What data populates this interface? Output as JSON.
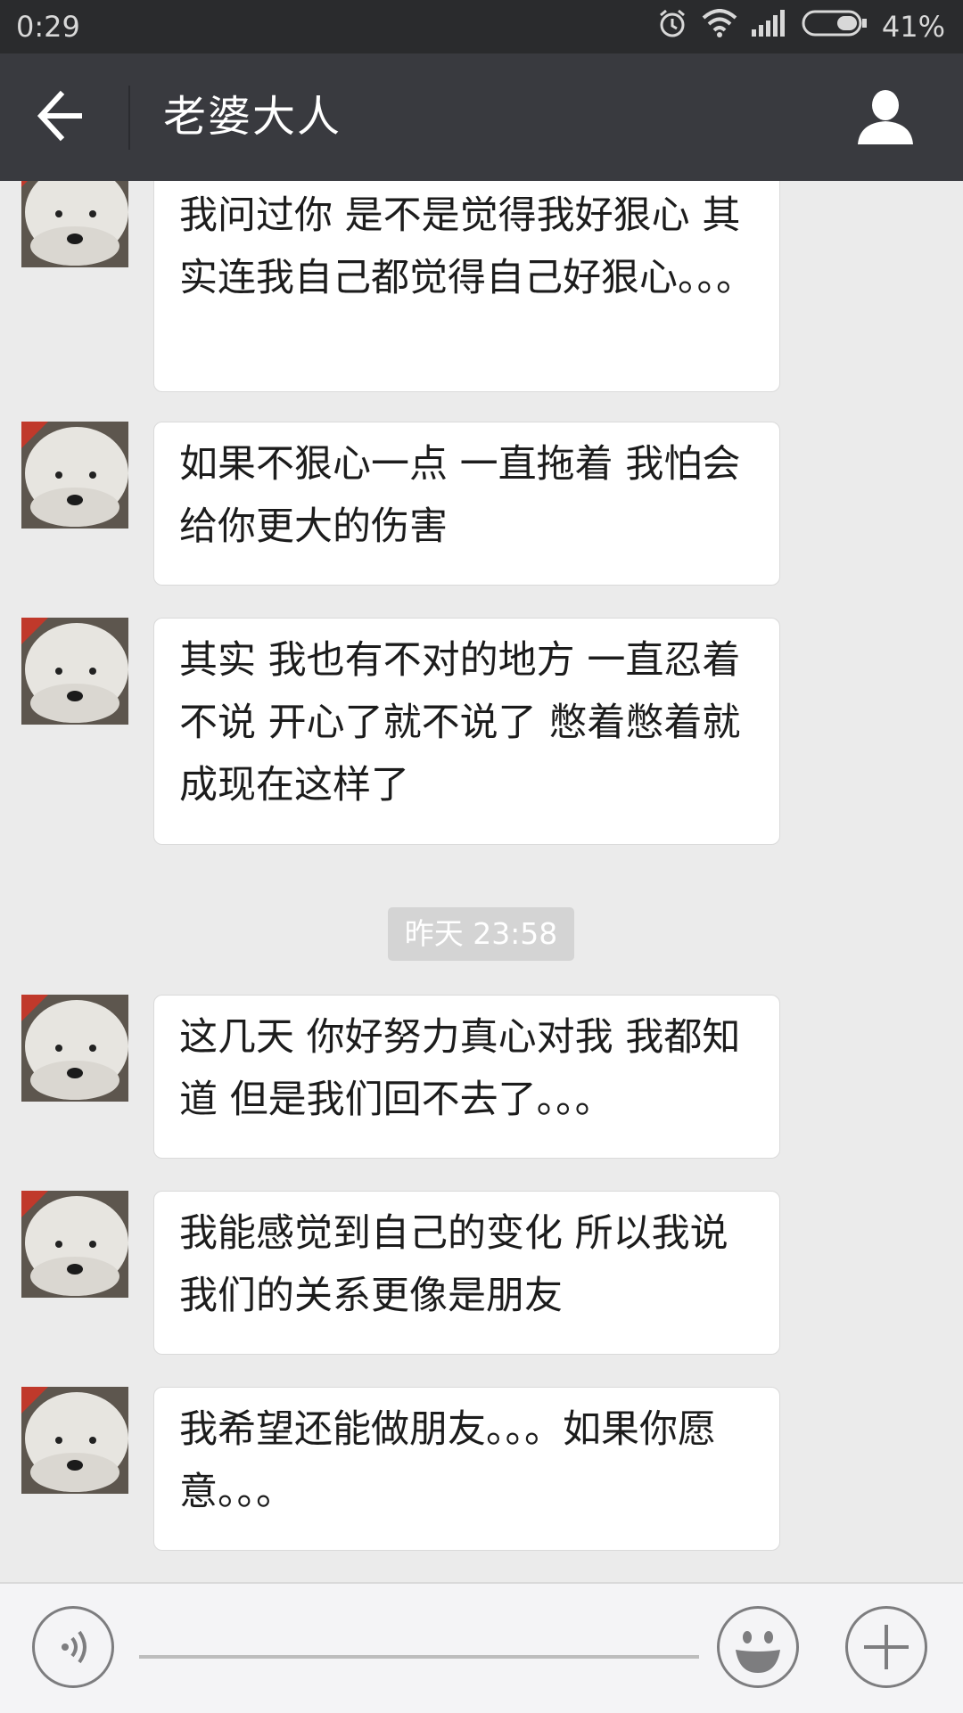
{
  "status_bar": {
    "time": "0:29",
    "battery_percent": "41%",
    "icons": [
      "alarm-icon",
      "wifi-icon",
      "signal-icon",
      "battery-icon"
    ]
  },
  "header": {
    "title": "老婆大人",
    "back_icon": "back-arrow-icon",
    "profile_icon": "person-icon"
  },
  "messages": [
    {
      "text": "我问过你 是不是觉得我好狠心 其实连我自己都觉得自己好狠心。。。"
    },
    {
      "text": "如果不狠心一点 一直拖着 我怕会给你更大的伤害"
    },
    {
      "text": "其实 我也有不对的地方 一直忍着不说 开心了就不说了 憋着憋着就成现在这样了"
    },
    {
      "timestamp": "昨天 23:58"
    },
    {
      "text": "这几天 你好努力真心对我 我都知道 但是我们回不去了。。。"
    },
    {
      "text": "我能感觉到自己的变化 所以我说 我们的关系更像是朋友"
    },
    {
      "text": "我希望还能做朋友。。。如果你愿意。。。"
    }
  ],
  "input_bar": {
    "voice_icon": "voice-icon",
    "emoji_icon": "emoji-icon",
    "plus_icon": "plus-icon",
    "input_value": ""
  },
  "colors": {
    "status_bar": "#2a2b2d",
    "title_bar": "#393a3f",
    "chat_background": "#ebebeb",
    "bubble": "#ffffff",
    "timestamp_badge": "#d4d4d4"
  }
}
